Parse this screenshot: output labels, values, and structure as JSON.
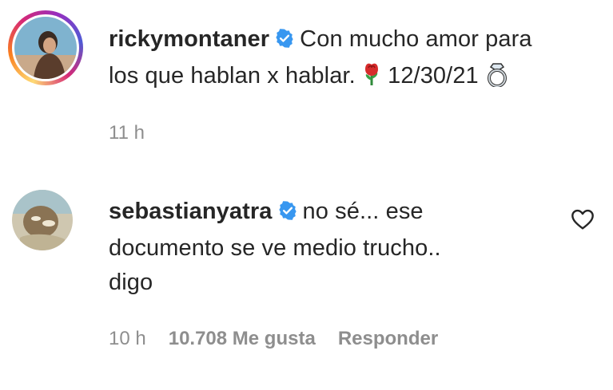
{
  "comments": [
    {
      "username": "rickymontaner",
      "verified": true,
      "text_line1": "Con mucho amor para",
      "text_line2_pre": "los que hablan x hablar.",
      "text_line2_post": "12/30/21",
      "emoji_rose": "rose",
      "emoji_ring": "ring",
      "time": "11 h"
    },
    {
      "username": "sebastianyatra",
      "verified": true,
      "text_line1": "no sé... ese",
      "text_line2": "documento se ve medio trucho..",
      "text_line3": "digo",
      "time": "10 h",
      "likes": "10.708 Me gusta",
      "reply": "Responder"
    }
  ],
  "colors": {
    "verified_blue": "#3897f0",
    "meta_gray": "#8e8e8e",
    "text": "#262626"
  }
}
